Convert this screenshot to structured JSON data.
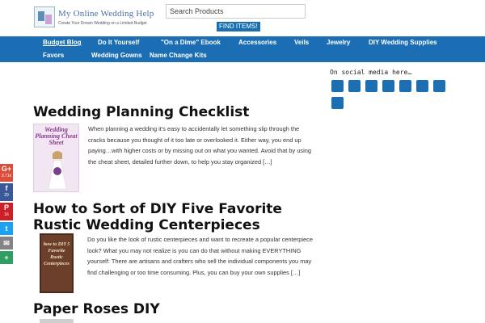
{
  "header": {
    "logo_title": "My Online Wedding Help",
    "logo_tagline": "Create Your Dream Wedding on a Limited Budget",
    "search_placeholder": "Search Products",
    "find_button": "FIND ITEMS!"
  },
  "nav": {
    "items": [
      {
        "label": "Budget Blog",
        "active": true
      },
      {
        "label": "Do It Yourself"
      },
      {
        "label": "\"On a Dime\" Ebook"
      },
      {
        "label": "Accessories"
      },
      {
        "label": "Veils"
      },
      {
        "label": "Jewelry"
      },
      {
        "label": "DIY Wedding Supplies"
      },
      {
        "label": "Favors"
      },
      {
        "label": "Wedding Gowns"
      },
      {
        "label": "Name Change Kits"
      }
    ]
  },
  "sidebar": {
    "social_title": "On social media here…",
    "social_buttons": [
      "social-button",
      "social-button",
      "social-button",
      "social-button",
      "social-button",
      "social-button",
      "social-button",
      "social-button"
    ]
  },
  "share_bar": [
    {
      "icon": "google-plus-icon",
      "glyph": "G+",
      "count": "3.71k",
      "color": "#dd4b39"
    },
    {
      "icon": "facebook-icon",
      "glyph": "f",
      "count": "29",
      "color": "#3b5998"
    },
    {
      "icon": "pinterest-icon",
      "glyph": "P",
      "count": "16",
      "color": "#cb2027"
    },
    {
      "icon": "twitter-icon",
      "glyph": "t",
      "count": "",
      "color": "#1da1f2"
    },
    {
      "icon": "email-icon",
      "glyph": "✉",
      "count": "",
      "color": "#848484"
    },
    {
      "icon": "more-share-icon",
      "glyph": "+",
      "count": "",
      "color": "#2f9e62"
    }
  ],
  "posts": [
    {
      "title": "Wedding Planning Checklist",
      "thumb_text": "Wedding Planning Cheat Sheet",
      "excerpt": "When planning a wedding it’s easy to accidentally let something slip through the cracks because you thought of it too late or overlooked it. Either way, you end up paying…with higher costs or by missing out on what you wanted. Avoid that by using the cheat sheet, detailed further down, to help you stay organized […]"
    },
    {
      "title": "How to Sort of DIY Five Favorite Rustic Wedding Centerpieces",
      "thumb_text": "how to DIY 5 Favorite Rustic Centerpieces",
      "excerpt": "Do you like the look of rustic centerpieces and want to recreate a popular centerpiece look? What you may not realize is you can do that without making EVERYTHING yourself: There are artisans and crafters who sell the individual components you may find challenging or too time consuming. Plus, you can buy your own supplies […]"
    },
    {
      "title": "Paper Roses DIY"
    }
  ]
}
